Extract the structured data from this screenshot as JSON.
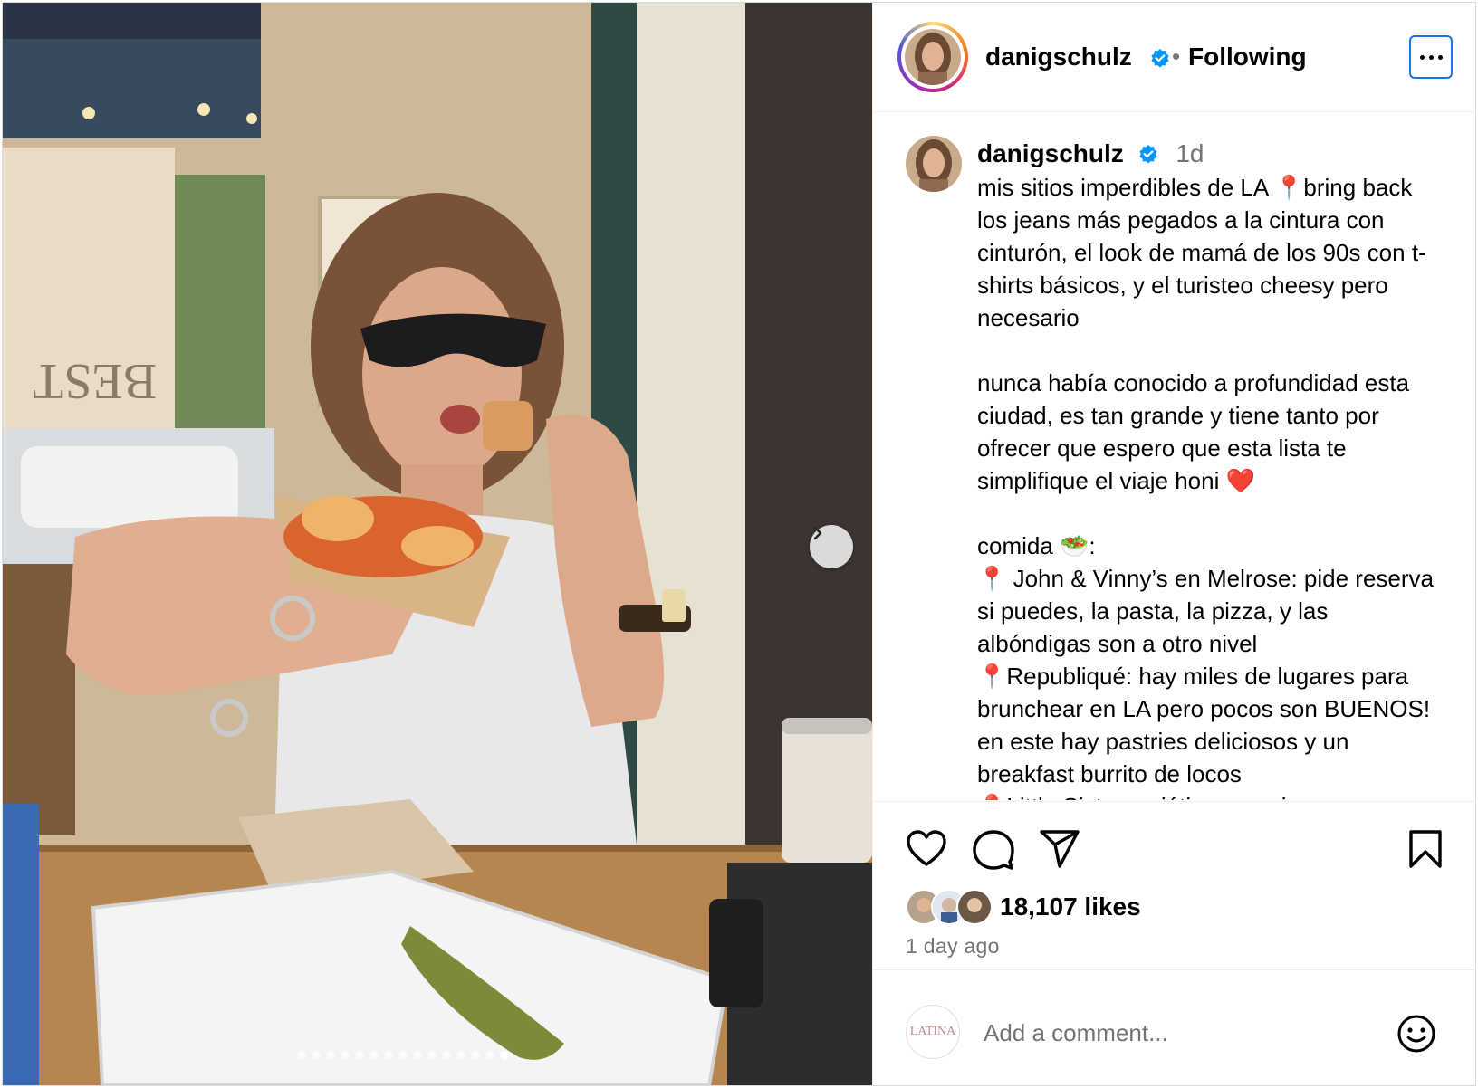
{
  "post": {
    "username": "danigschulz",
    "follow_status": "Following",
    "separator": "•",
    "time_short": "1d",
    "caption": [
      {
        "type": "text",
        "value": "mis sitios imperdibles de LA "
      },
      {
        "type": "pin",
        "value": "📍"
      },
      {
        "type": "text",
        "value": "bring back los jeans más pegados a la cintura con cinturón, el look de mamá de los 90s con t-shirts básicos, y el turisteo cheesy pero necesario\n\nnunca había conocido a profundidad esta ciudad, es tan grande y tiene tanto por ofrecer que espero que esta lista te simplifique el viaje honi "
      },
      {
        "type": "pin",
        "value": "❤️"
      },
      {
        "type": "text",
        "value": "\n\ncomida 🥗:\n"
      },
      {
        "type": "pin",
        "value": "📍"
      },
      {
        "type": "text",
        "value": " John & Vinny’s en Melrose: pide reserva si puedes, la pasta, la pizza, y las albóndigas son a otro nivel\n"
      },
      {
        "type": "pin",
        "value": "📍"
      },
      {
        "type": "text",
        "value": "Republiqué: hay miles de lugares para brunchear en LA pero pocos son BUENOS! en este hay pastries deliciosos y un breakfast burrito de locos\n"
      },
      {
        "type": "pin",
        "value": "📍"
      },
      {
        "type": "text",
        "value": "Little Sister: asiática muy rica"
      }
    ],
    "likes": "18,107 likes",
    "time_long": "1 day ago",
    "carousel": {
      "total": 15,
      "active": 14
    }
  },
  "comment": {
    "placeholder": "Add a comment...",
    "user_avatar_text": "LATINA"
  },
  "icons": {
    "more": "more-options-icon",
    "like": "heart-icon",
    "comment": "comment-icon",
    "share": "share-icon",
    "save": "bookmark-icon",
    "emoji": "emoji-icon",
    "next": "chevron-right-icon"
  },
  "colors": {
    "verified": "#0095f6",
    "secondary_text": "#737373",
    "focus_outline": "#1a73e8"
  }
}
